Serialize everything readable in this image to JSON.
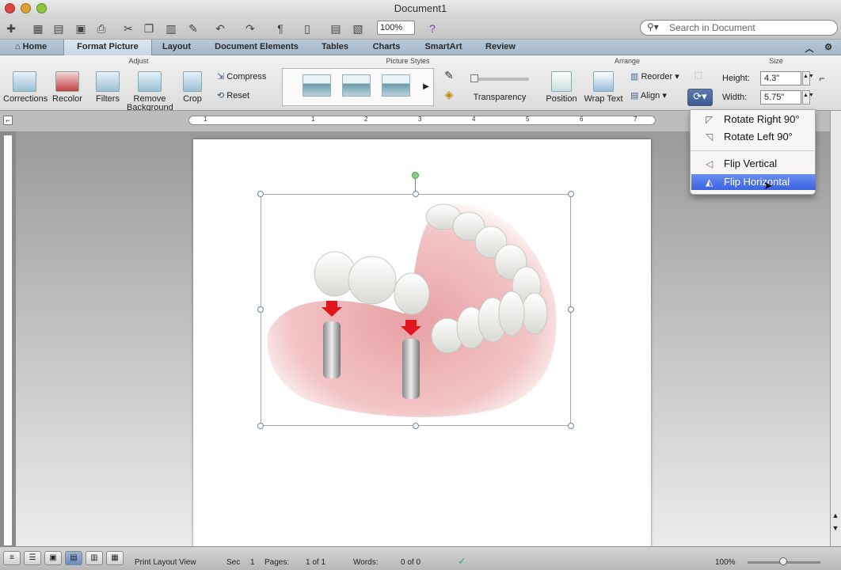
{
  "window": {
    "title": "Document1"
  },
  "toolbar": {
    "zoom": "100%",
    "search_placeholder": "Search in Document"
  },
  "tabs": [
    {
      "label": "Home"
    },
    {
      "label": "Format Picture"
    },
    {
      "label": "Layout"
    },
    {
      "label": "Document Elements"
    },
    {
      "label": "Tables"
    },
    {
      "label": "Charts"
    },
    {
      "label": "SmartArt"
    },
    {
      "label": "Review"
    }
  ],
  "ribbon": {
    "groups": {
      "adjust": "Adjust",
      "picture_styles": "Picture Styles",
      "arrange": "Arrange",
      "size": "Size"
    },
    "adjust": {
      "corrections": "Corrections",
      "recolor": "Recolor",
      "filters": "Filters",
      "remove_background": "Remove Background",
      "crop": "Crop",
      "compress": "Compress",
      "reset": "Reset"
    },
    "transparency": "Transparency",
    "arrange": {
      "position": "Position",
      "wrap_text": "Wrap Text",
      "reorder": "Reorder",
      "align": "Align"
    },
    "size": {
      "height_label": "Height:",
      "height_value": "4.3\"",
      "width_label": "Width:",
      "width_value": "5.75\""
    }
  },
  "ruler": {
    "numbers": [
      "1",
      "1",
      "2",
      "3",
      "4",
      "5",
      "6",
      "7"
    ]
  },
  "rotate_menu": {
    "items": [
      {
        "label": "Rotate Right 90°",
        "icon": "rotate-right-icon"
      },
      {
        "label": "Rotate Left 90°",
        "icon": "rotate-left-icon"
      },
      {
        "label": "Flip Vertical",
        "icon": "flip-vertical-icon"
      },
      {
        "label": "Flip Horizontal",
        "icon": "flip-horizontal-icon",
        "highlighted": true
      }
    ]
  },
  "status": {
    "view": "Print Layout View",
    "sec_label": "Sec",
    "sec_value": "1",
    "pages_label": "Pages:",
    "pages_value": "1 of 1",
    "words_label": "Words:",
    "words_value": "0 of 0",
    "zoom": "100%"
  }
}
